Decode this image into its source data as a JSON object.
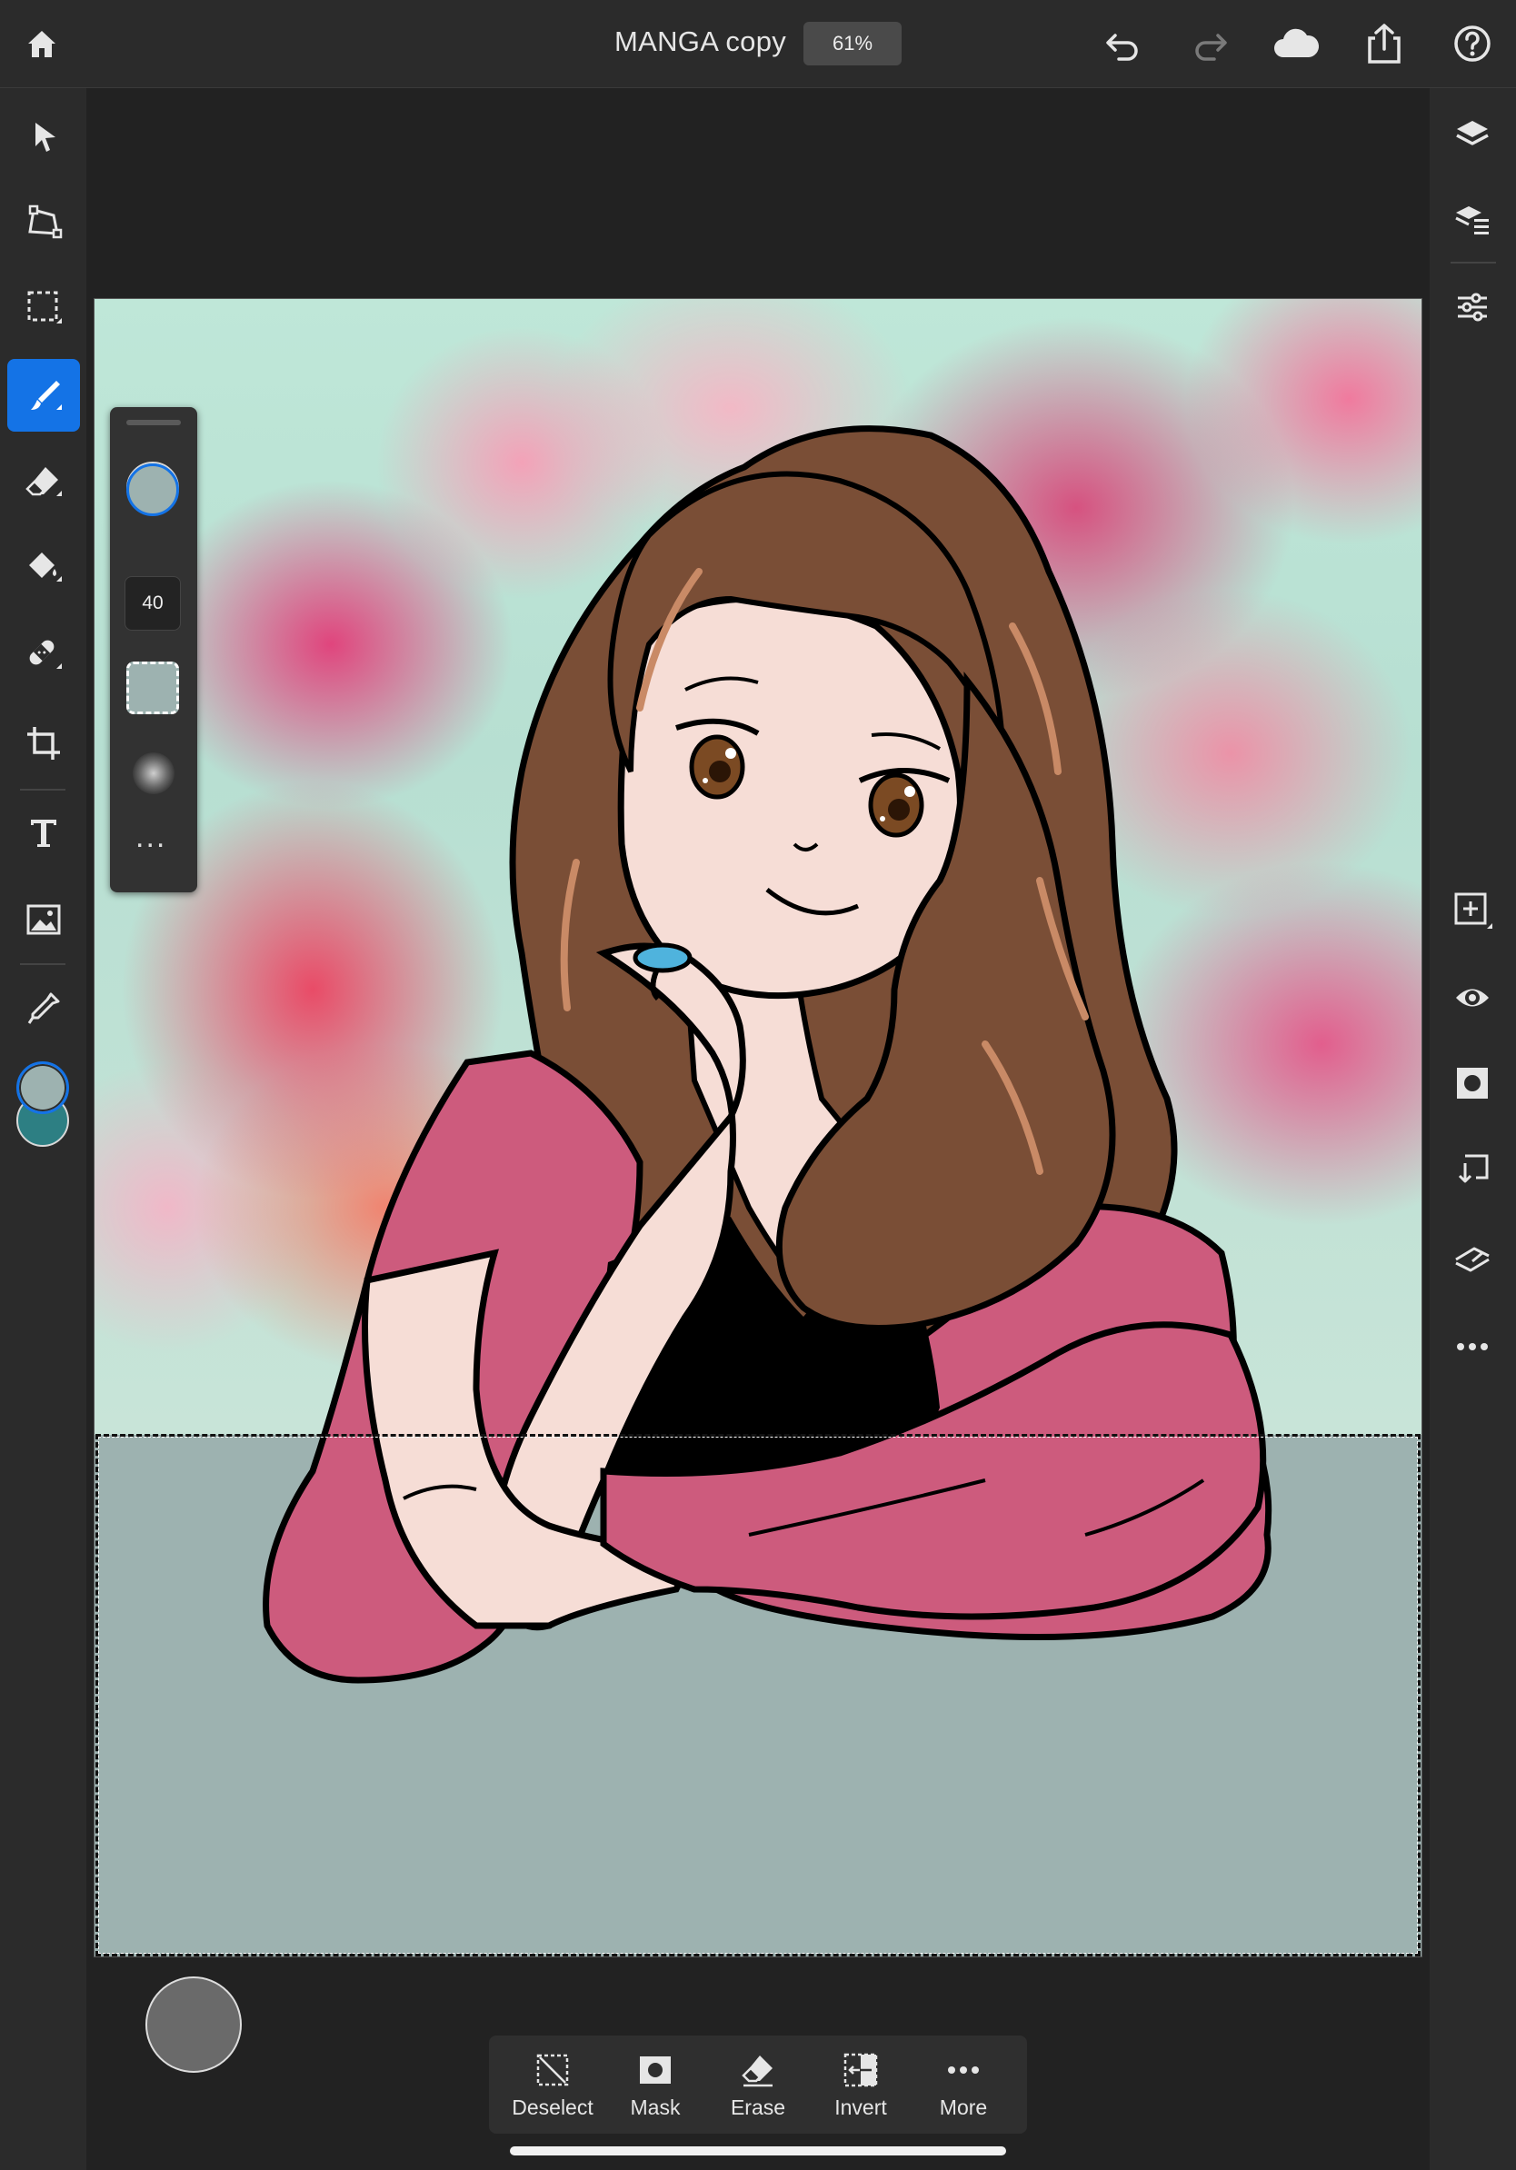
{
  "document": {
    "title": "MANGA copy",
    "zoom": "61%"
  },
  "topbar": {
    "icons": [
      "home-icon",
      "undo-icon",
      "redo-icon",
      "cloud-icon",
      "share-icon",
      "help-icon"
    ]
  },
  "left_toolbar": {
    "tools": [
      "move-tool",
      "transform-tool",
      "marquee-select-tool",
      "brush-tool",
      "eraser-tool",
      "fill-tool",
      "healing-tool",
      "crop-tool",
      "type-tool",
      "place-image-tool",
      "eyedropper-tool"
    ],
    "active_tool": "brush-tool",
    "foreground_color": "#9db2b0",
    "background_color": "#2d7f83"
  },
  "brush_panel": {
    "size": "40",
    "foreground_color": "#9db2b0",
    "background_color": "#2d7f83",
    "more_label": "..."
  },
  "right_toolbar": {
    "icons": [
      "layers-icon",
      "layer-properties-icon",
      "adjustments-icon",
      "add-layer-icon",
      "visibility-icon",
      "mask-icon",
      "clipping-icon",
      "merge-icon",
      "more-icon"
    ]
  },
  "selection_actions": [
    {
      "label": "Deselect",
      "icon": "deselect-icon"
    },
    {
      "label": "Mask",
      "icon": "mask-icon"
    },
    {
      "label": "Erase",
      "icon": "eraser-icon"
    },
    {
      "label": "Invert",
      "icon": "invert-icon"
    },
    {
      "label": "More",
      "icon": "more-icon"
    }
  ],
  "colors": {
    "accent": "#1473e6",
    "canvas_floor": "#9db2b0",
    "hair": "#7a4e36",
    "shawl": "#cd5b7d",
    "skin": "#f6ddd6"
  }
}
